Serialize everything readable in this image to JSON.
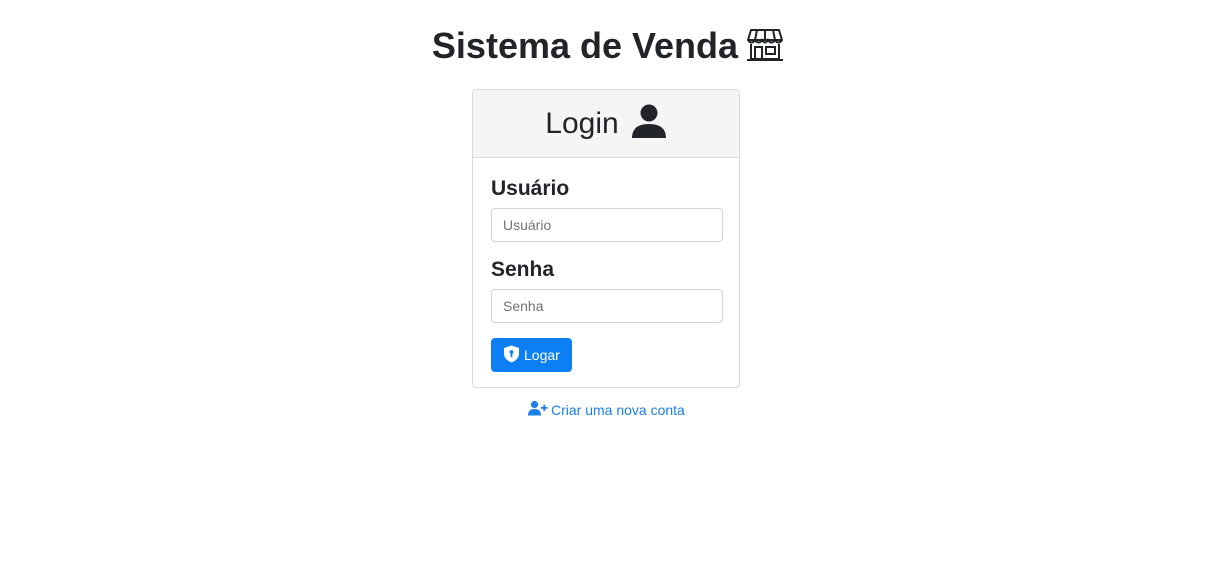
{
  "app": {
    "title": "Sistema de Venda",
    "title_icon": "shop-icon"
  },
  "login_card": {
    "header": "Login",
    "header_icon": "user-icon",
    "username_label": "Usuário",
    "username_placeholder": "Usuário",
    "username_value": "",
    "password_label": "Senha",
    "password_placeholder": "Senha",
    "password_value": "",
    "submit_label": "Logar",
    "submit_icon": "shield-icon"
  },
  "create_account": {
    "label": "Criar uma nova conta",
    "icon": "user-plus-icon"
  },
  "colors": {
    "primary": "#0d7ff5",
    "link": "#1a7fe6",
    "text": "#212529",
    "header_bg": "#f5f5f5"
  }
}
